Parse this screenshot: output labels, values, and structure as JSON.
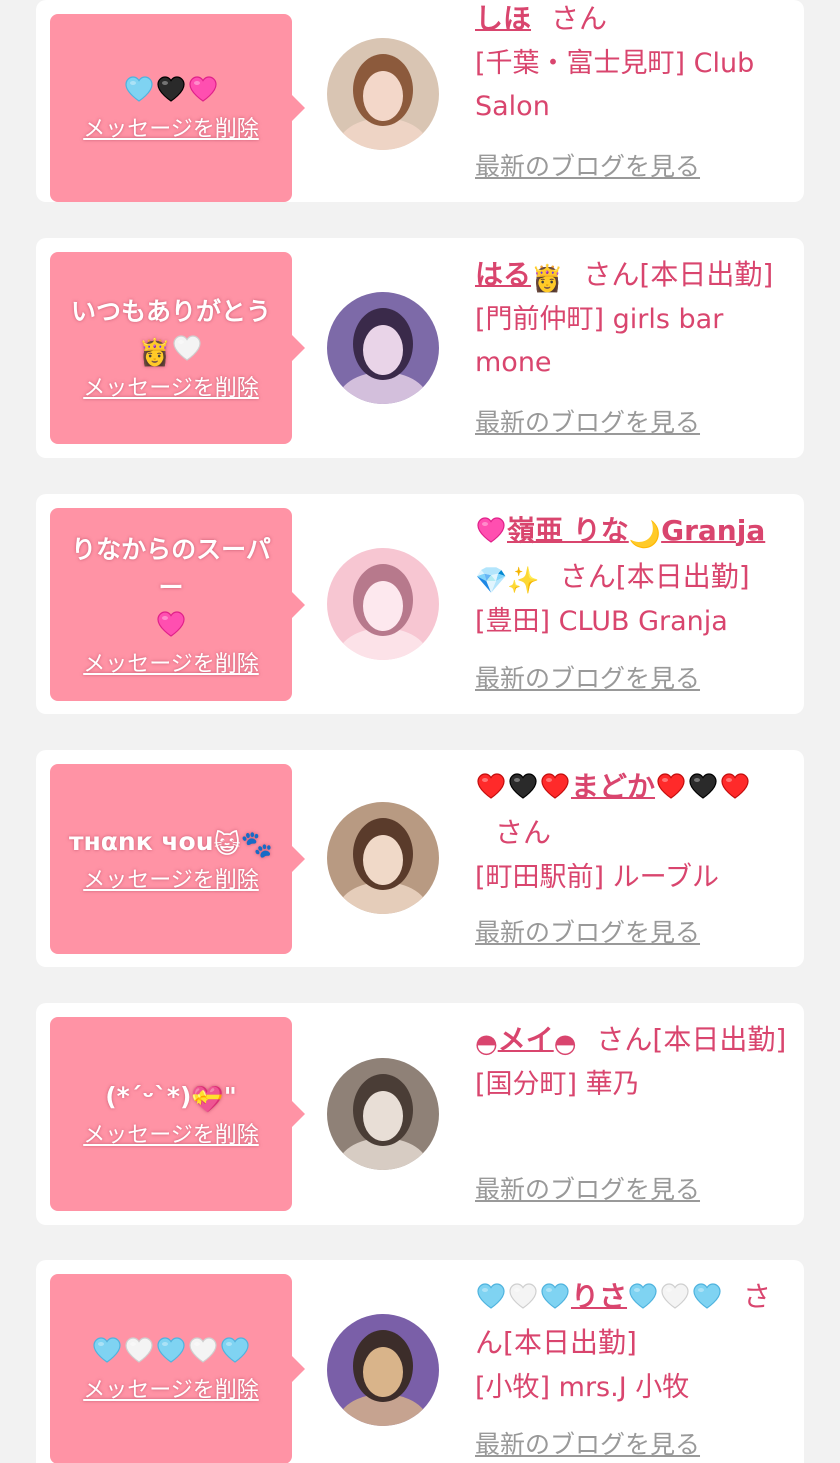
{
  "colors": {
    "page_background": "#f2f2f2",
    "card_background": "#ffffff",
    "bubble_pink": "#ff93a5",
    "name_pink": "#d9456e",
    "blog_link_gray": "#999999"
  },
  "labels": {
    "delete_message": "メッセージを削除",
    "san": "さん",
    "latest_blog": "最新のブログを見る"
  },
  "cards": [
    {
      "message": "",
      "message_icons": [
        "heart-blue",
        "heart-black",
        "heart-magenta"
      ],
      "name_prefix_icons": [],
      "name": "しほ",
      "name_suffix_icons": [],
      "after_san": "",
      "shop": "[千葉・富士見町] Club Salon",
      "avatar_colors": [
        "#d9c5b3",
        "#f3d7c9",
        "#8c5a3c"
      ]
    },
    {
      "message": "いつもありがとう",
      "message_icons": [
        "princess",
        "heart-white"
      ],
      "name_prefix_icons": [],
      "name": "はる",
      "name_suffix_icons": [
        "princess"
      ],
      "after_san": "[本日出勤]",
      "shop": "[門前仲町] girls bar mone",
      "avatar_colors": [
        "#7d6aa8",
        "#e9d4e8",
        "#3a2a4a"
      ]
    },
    {
      "message": "りなからのスーパー",
      "message_icons": [
        "heart-magenta"
      ],
      "name_prefix_icons": [
        "heart-magenta"
      ],
      "name": "嶺亜 りな",
      "name_suffix_icons": [
        "moon"
      ],
      "name_suffix_text": "Granja",
      "name_suffix_icons_2": [
        "gem",
        "sparkles"
      ],
      "after_san": "[本日出勤]",
      "shop": "[豊田] CLUB Granja",
      "avatar_colors": [
        "#f7c6d2",
        "#fde8ee",
        "#b7798c"
      ]
    },
    {
      "message": "тнαnк чou",
      "message_icons": [
        "cat",
        "paws"
      ],
      "name_prefix_icons": [
        "heart-red",
        "heart-black",
        "heart-red"
      ],
      "name": "まどか",
      "name_suffix_icons": [
        "heart-red",
        "heart-black",
        "heart-red"
      ],
      "after_san": "",
      "shop": "[町田駅前] ルーブル",
      "avatar_colors": [
        "#b89a82",
        "#f0d9c8",
        "#5a3b2b"
      ]
    },
    {
      "message": "(*ˊᵕˋ*)",
      "message_icons": [
        "gift-heart"
      ],
      "message_after": "\"",
      "name_prefix_icons": [
        "eye-mark"
      ],
      "name": "メイ",
      "name_suffix_icons": [
        "eye-mark"
      ],
      "after_san": "[本日出勤]",
      "shop": "[国分町] 華乃",
      "avatar_colors": [
        "#8f8177",
        "#e8ded6",
        "#4a3d36"
      ]
    },
    {
      "message": "",
      "message_icons": [
        "heart-blue",
        "heart-white",
        "heart-blue",
        "heart-white",
        "heart-blue"
      ],
      "name_prefix_icons": [
        "heart-blue",
        "heart-white",
        "heart-blue"
      ],
      "name": "りさ",
      "name_suffix_icons": [
        "heart-blue",
        "heart-white",
        "heart-blue"
      ],
      "after_san": "[本日出勤]",
      "shop": "[小牧] mrs.J 小牧",
      "avatar_colors": [
        "#7a5fa8",
        "#d9b48a",
        "#3c2d2a"
      ]
    }
  ]
}
